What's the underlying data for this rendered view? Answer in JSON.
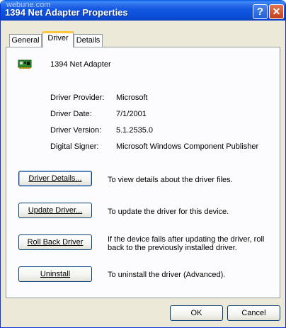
{
  "window": {
    "watermark": "webune.com",
    "title": "1394 Net Adapter Properties",
    "help_glyph": "?",
    "close_glyph": "✕"
  },
  "tabs": [
    {
      "label": "General"
    },
    {
      "label": "Driver",
      "selected": true
    },
    {
      "label": "Details"
    }
  ],
  "device": {
    "icon": "network-adapter-icon",
    "name": "1394 Net Adapter"
  },
  "properties": [
    {
      "label": "Driver Provider:",
      "value": "Microsoft"
    },
    {
      "label": "Driver Date:",
      "value": "7/1/2001"
    },
    {
      "label": "Driver Version:",
      "value": "5.1.2535.0"
    },
    {
      "label": "Digital Signer:",
      "value": "Microsoft Windows Component Publisher"
    }
  ],
  "actions": [
    {
      "label": "Driver Details...",
      "description": "To view details about the driver files."
    },
    {
      "label": "Update Driver...",
      "description": "To update the driver for this device."
    },
    {
      "label": "Roll Back Driver",
      "description": "If the device fails after updating the driver, roll back to the previously installed driver."
    },
    {
      "label": "Uninstall",
      "description": "To uninstall the driver (Advanced)."
    }
  ],
  "footer": {
    "ok_label": "OK",
    "cancel_label": "Cancel"
  },
  "colors": {
    "title_bar": "#0a5be8",
    "dialog_bg": "#ece9d8",
    "active_tab_accent": "#ffc83c"
  }
}
